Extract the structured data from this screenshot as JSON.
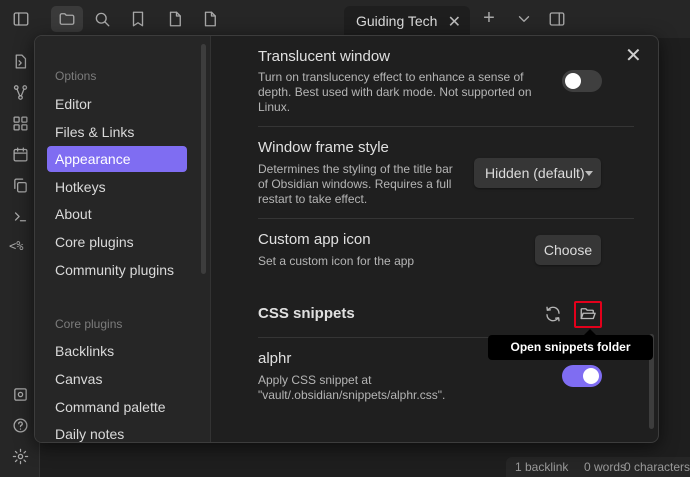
{
  "tab": {
    "title": "Guiding Tech",
    "close_glyph": "✕",
    "new_tab_glyph": "+"
  },
  "ribbon": {
    "tags_label": "<%"
  },
  "status_bar": {
    "backlinks": "1 backlink",
    "words": "0 words",
    "characters": "0 characters"
  },
  "settings_nav": {
    "options_heading": "Options",
    "options_items": [
      "Editor",
      "Files & Links",
      "Appearance",
      "Hotkeys",
      "About",
      "Core plugins",
      "Community plugins"
    ],
    "active_item": "Appearance",
    "core_plugins_heading": "Core plugins",
    "core_plugin_items": [
      "Backlinks",
      "Canvas",
      "Command palette",
      "Daily notes"
    ]
  },
  "modal": {
    "close_glyph": "✕"
  },
  "appearance": {
    "translucent_window": {
      "name": "Translucent window",
      "description": "Turn on translucency effect to enhance a sense of depth. Best used with dark mode. Not supported on Linux.",
      "enabled": false
    },
    "window_frame_style": {
      "name": "Window frame style",
      "description": "Determines the styling of the title bar of Obsidian windows. Requires a full restart to take effect.",
      "selected": "Hidden (default)"
    },
    "custom_app_icon": {
      "name": "Custom app icon",
      "description": "Set a custom icon for the app",
      "button_label": "Choose"
    },
    "css_snippets": {
      "heading": "CSS snippets",
      "tooltip": "Open snippets folder",
      "snippet": {
        "name": "alphr",
        "description": "Apply CSS snippet at \"vault/.obsidian/snippets/alphr.css\".",
        "enabled": true
      }
    }
  },
  "colors": {
    "accent": "#7f6df2",
    "highlight_box": "#e3001b",
    "background": "#1e1e1e"
  },
  "icons": {
    "topbar": [
      "sidebar-toggle-icon",
      "folder-icon",
      "search-icon",
      "bookmark-icon",
      "file-icon",
      "file-icon",
      "sidebar-right-icon"
    ],
    "ribbon": [
      "open-quick-switcher-icon",
      "graph-view-icon",
      "canvas-icon",
      "calendar-icon",
      "copy-icon",
      "terminal-icon",
      "tags-icon",
      "vault-icon",
      "help-icon",
      "settings-icon"
    ],
    "css_snippets": [
      "reload-icon",
      "folder-open-icon"
    ]
  }
}
